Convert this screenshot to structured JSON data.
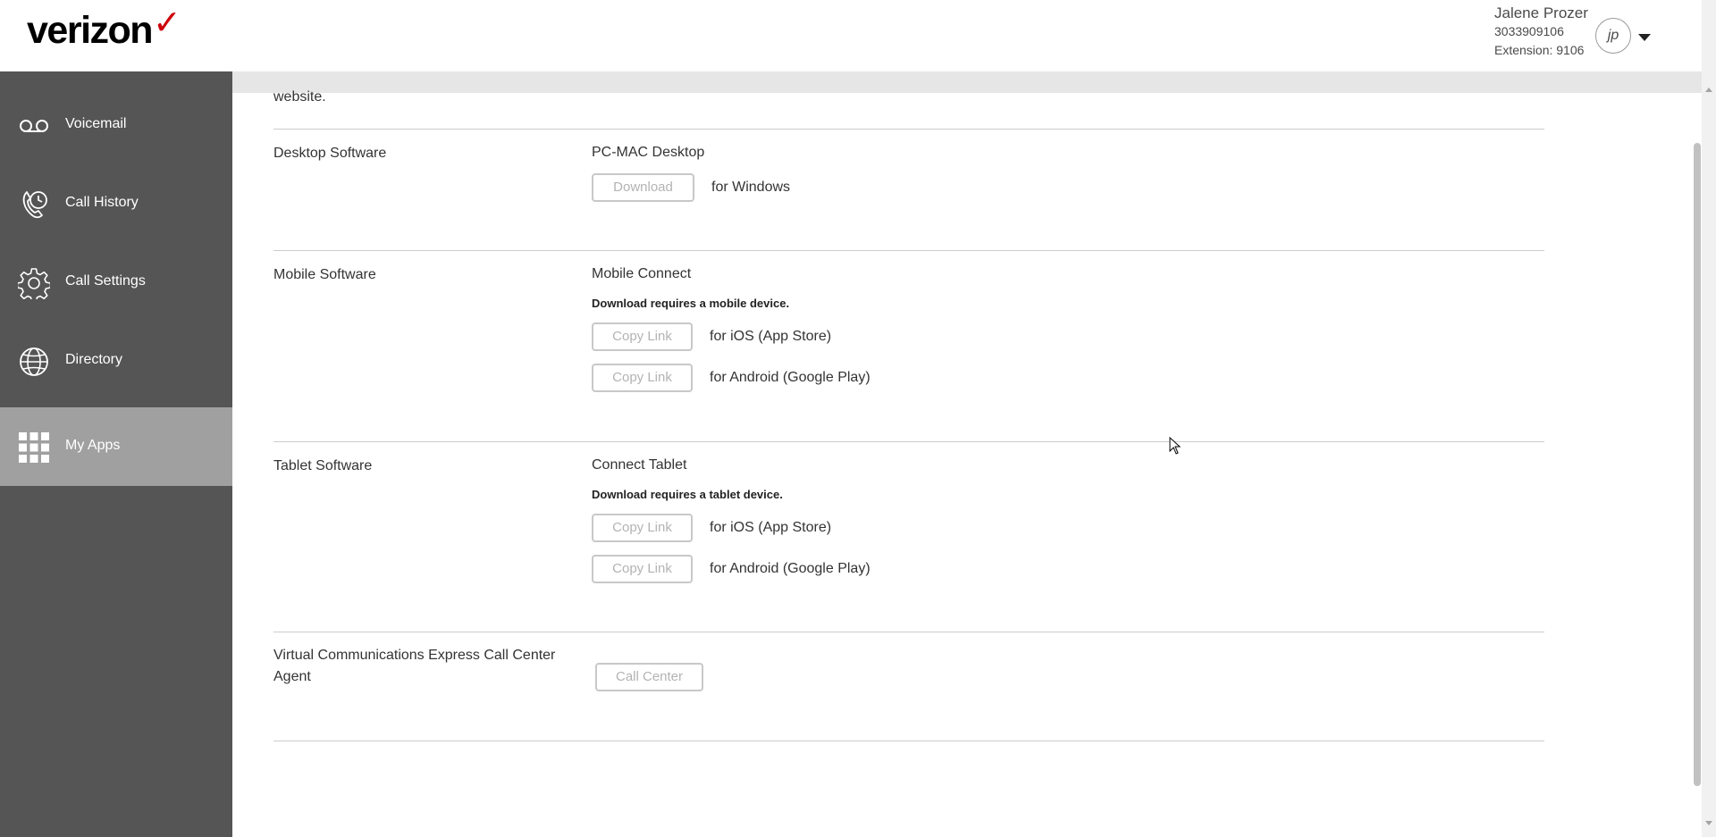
{
  "header": {
    "brand": "verizon",
    "brand_mark": "✓",
    "user": {
      "name": "Jalene Prozer",
      "phone": "3033909106",
      "extension": "Extension: 9106",
      "initials": "jp"
    }
  },
  "sidebar": {
    "items": [
      {
        "label": "Voicemail",
        "icon": "voicemail-icon"
      },
      {
        "label": "Call History",
        "icon": "call-history-icon"
      },
      {
        "label": "Call Settings",
        "icon": "gear-icon"
      },
      {
        "label": "Directory",
        "icon": "globe-icon"
      },
      {
        "label": "My Apps",
        "icon": "apps-grid-icon",
        "active": true
      }
    ]
  },
  "main": {
    "intro_tail": "website.",
    "desktop": {
      "title": "Desktop Software",
      "product": "PC-MAC Desktop",
      "button": "Download",
      "button_suffix": "for Windows"
    },
    "mobile": {
      "title": "Mobile Software",
      "product": "Mobile Connect",
      "note": "Download requires a mobile device.",
      "ios_button": "Copy Link",
      "ios_suffix": "for iOS (App Store)",
      "android_button": "Copy Link",
      "android_suffix": "for Android (Google Play)"
    },
    "tablet": {
      "title": "Tablet Software",
      "product": "Connect Tablet",
      "note": "Download requires a tablet device.",
      "ios_button": "Copy Link",
      "ios_suffix": "for iOS (App Store)",
      "android_button": "Copy Link",
      "android_suffix": "for Android (Google Play)"
    },
    "call_center": {
      "title": "Virtual Communications Express Call Center Agent",
      "button": "Call Center"
    }
  },
  "colors": {
    "brand_red": "#cd040b",
    "sidebar_bg": "#555555",
    "sidebar_active": "#a0a0a0",
    "button_border": "#c8c8c8",
    "button_text": "#b3b3b3"
  }
}
